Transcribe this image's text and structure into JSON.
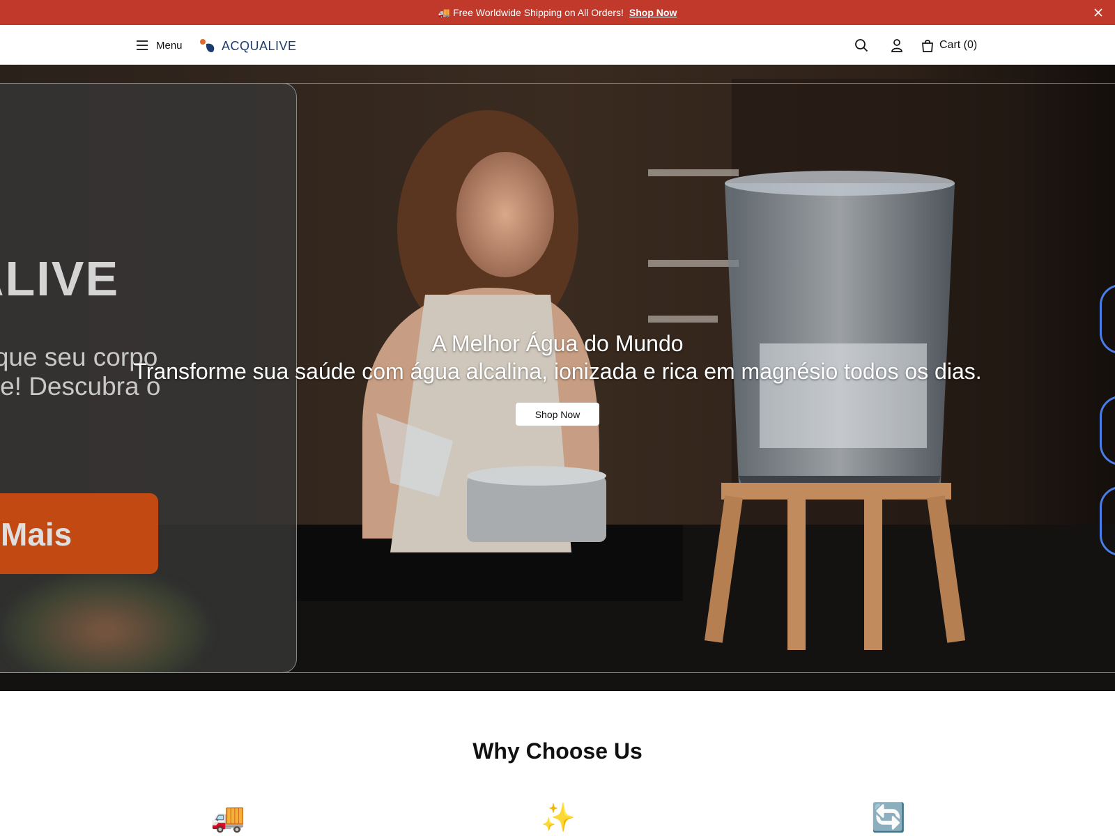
{
  "announcement": {
    "icon": "truck-icon",
    "emoji": "🚚",
    "message": "Free Worldwide Shipping on All Orders!",
    "link_label": "Shop Now"
  },
  "header": {
    "menu_label": "Menu",
    "logo_text": "ACQUALIVE",
    "cart_label": "Cart (0)",
    "icons": [
      "menu-icon",
      "search-icon",
      "user-icon",
      "bag-icon"
    ]
  },
  "hero": {
    "title": "A Melhor Água do Mundo",
    "subtitle": "Transforme sua saúde com água alcalina, ionizada e rica em magnésio todos os dias.",
    "cta_label": "Shop Now",
    "background_image": "woman pouring water in kitchen next to water purifier",
    "card": {
      "brand_fragment": "ALIVE",
      "text_line1": "a que seu corpo",
      "text_line2": "ece! Descubra o",
      "button_label": "Mais"
    }
  },
  "why": {
    "title": "Why Choose Us",
    "features": [
      {
        "icon": "truck-icon",
        "emoji": "🚚"
      },
      {
        "icon": "sparkles-icon",
        "emoji": "✨"
      },
      {
        "icon": "refresh-icon",
        "emoji": "🔄"
      }
    ]
  },
  "colors": {
    "announcement_bg": "#c0392b",
    "brand_blue": "#1d3b6e",
    "accent_orange": "#c24a12",
    "bubble_blue": "#4a7de8"
  }
}
